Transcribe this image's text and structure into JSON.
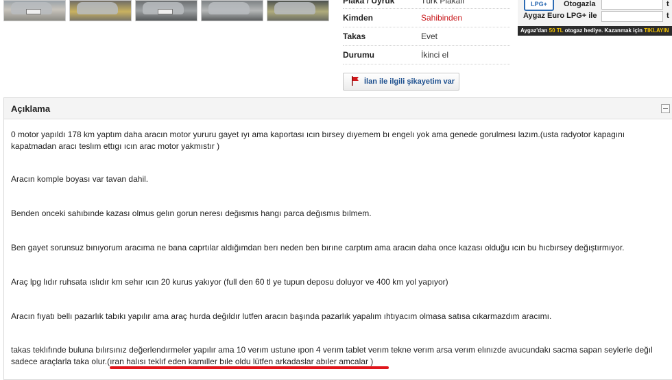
{
  "details": {
    "rows": [
      {
        "label": "Plaka / Uyruk",
        "value": "Türk Plakalı"
      },
      {
        "label": "Kimden",
        "value": "Sahibinden"
      },
      {
        "label": "Takas",
        "value": "Evet"
      },
      {
        "label": "Durumu",
        "value": "İkinci el"
      }
    ]
  },
  "complain_button": {
    "label": "İlan ile ilgili şikayetim var"
  },
  "ad": {
    "logo": "LPG+",
    "line1": "Otogazla",
    "line2": "Aygaz Euro LPG+ ile",
    "tail1": "t",
    "tail2": "t",
    "bottom_pre": "Aygaz'dan ",
    "bottom_amount": "50 TL",
    "bottom_mid": " otogaz hediye. Kazanmak için ",
    "bottom_cta": "TIKLAYIN"
  },
  "description": {
    "title": "Açıklama",
    "paragraphs": [
      "0 motor yapıldı 178 km yaptım daha aracın motor yururu gayet ıyı ama kaportası ıcın bırsey dıyemem bı engelı yok ama genede gorulmesı lazım.(usta radyotor kapagını kapatmadan aracı teslım ettıgı ıcın arac motor yakmıstır )",
      "Aracın komple boyası var tavan dahil.",
      "Benden onceki sahıbınde kazası olmus gelın gorun neresı değısmıs hangı parca değısmıs bılmem.",
      "Ben gayet sorunsuz bınıyorum aracıma ne bana caprtılar aldığımdan berı neden ben bırıne carptım ama aracın daha once kazası olduğu ıcın bu hıcbırsey değıştırmıyor.",
      "Araç lpg lıdır ruhsata ıslıdır km sehır ıcın 20 kurus yakıyor (full den 60 tl ye tupun deposu doluyor ve 400 km yol yapıyor)",
      "Aracın fıyatı bellı pazarlık tabıkı yapılır ama araç hurda değıldır lutfen aracın başında pazarlık yapalım ıhtıyacım olmasa satısa cıkarmazdım aracımı.",
      "takas teklıfınde buluna bılırsınız değerlendırmeler yapılır ama 10 verım ustune ıpon 4 verım tablet verım tekne verım arsa verım elınızde avucundakı sacma sapan seylerle değıl sadece araçlarla taka olur.(ıran halısı teklıf eden kamıller bıle oldu lütfen arkadaslar abıler amcalar )"
    ]
  },
  "colors": {
    "accent_red": "#c8191c",
    "link_blue": "#1d4f8e",
    "underline_red": "#e0161c"
  }
}
